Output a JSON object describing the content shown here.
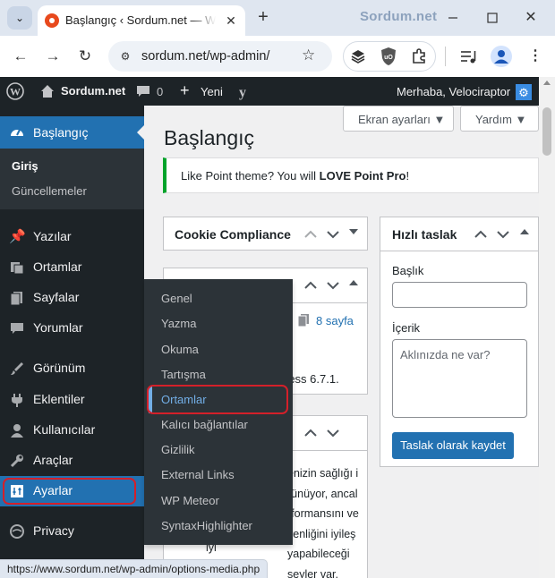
{
  "browser": {
    "tab_title": "Başlangıç ‹ Sordum.net — WordPress",
    "url": "sordum.net/wp-admin/",
    "watermark": "Sordum.net",
    "status_url": "https://www.sordum.net/wp-admin/options-media.php"
  },
  "adminbar": {
    "site_name": "Sordum.net",
    "comments_count": "0",
    "new_label": "Yeni",
    "greeting": "Merhaba, Velociraptor"
  },
  "sidebar": {
    "dashboard_label": "Başlangıç",
    "dashboard_sub": [
      "Giriş",
      "Güncellemeler"
    ],
    "items": [
      {
        "label": "Yazılar",
        "icon": "pin-icon"
      },
      {
        "label": "Ortamlar",
        "icon": "media-icon"
      },
      {
        "label": "Sayfalar",
        "icon": "pages-icon"
      },
      {
        "label": "Yorumlar",
        "icon": "comments-icon"
      },
      {
        "label": "Görünüm",
        "icon": "appearance-icon"
      },
      {
        "label": "Eklentiler",
        "icon": "plugins-icon"
      },
      {
        "label": "Kullanıcılar",
        "icon": "users-icon"
      },
      {
        "label": "Araçlar",
        "icon": "tools-icon"
      },
      {
        "label": "Ayarlar",
        "icon": "settings-icon"
      },
      {
        "label": "Privacy",
        "icon": "privacy-icon"
      }
    ]
  },
  "flyout": {
    "items": [
      "Genel",
      "Yazma",
      "Okuma",
      "Tartışma",
      "Ortamlar",
      "Kalıcı bağlantılar",
      "Gizlilik",
      "External Links",
      "WP Meteor",
      "SyntaxHighlighter"
    ],
    "active_index": 4
  },
  "content": {
    "screen_options": "Ekran ayarları ▼",
    "help": "Yardım ▼",
    "page_title": "Başlangıç",
    "notice_text": "Like Point theme? You will ",
    "notice_bold": "LOVE Point Pro",
    "notice_end": "!",
    "cookie_title": "Cookie Compliance",
    "glance_pages": "8 sayfa",
    "glance_version": "ress 6.7.1.",
    "health_lines": [
      "enizin sağlığı i",
      "rünüyor, ancal",
      "rformansını ve",
      "venliğini iyileş",
      "yapabileceği",
      "şeyler var."
    ],
    "health_prefix": "iyi",
    "quick_draft": {
      "title": "Hızlı taslak",
      "title_label": "Başlık",
      "content_label": "İçerik",
      "content_placeholder": "Aklınızda ne var?",
      "save_button": "Taslak olarak kaydet"
    }
  },
  "colors": {
    "wp_blue": "#2271b1",
    "admin_dark": "#1d2327",
    "highlight": "#d4202a"
  }
}
